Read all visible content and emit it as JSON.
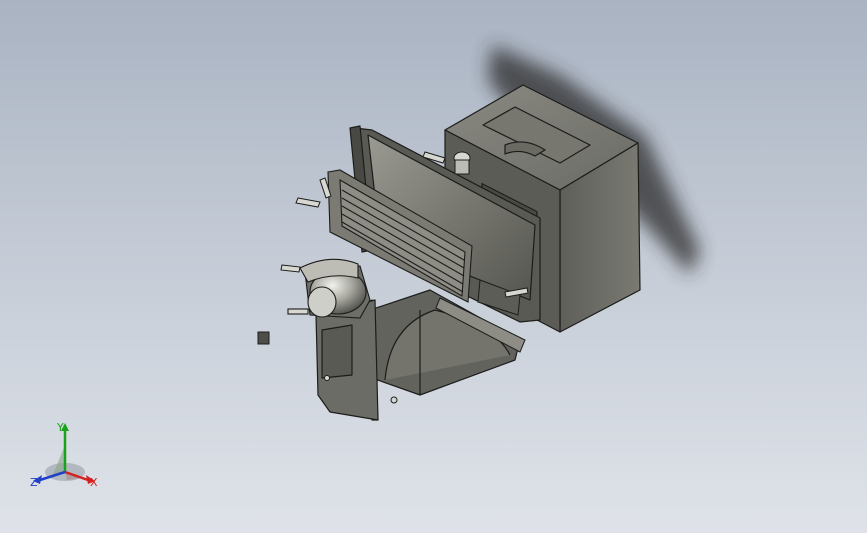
{
  "viewport": {
    "background_top": "#a9b3c2",
    "background_bottom": "#dfe3e9",
    "model_color": "#6f6f69",
    "edge_color": "#1c1c1a"
  },
  "triad": {
    "x_label": "X",
    "y_label": "Y",
    "z_label": "Z",
    "x_color": "#d42020",
    "y_color": "#1aa31a",
    "z_color": "#2040c8"
  }
}
